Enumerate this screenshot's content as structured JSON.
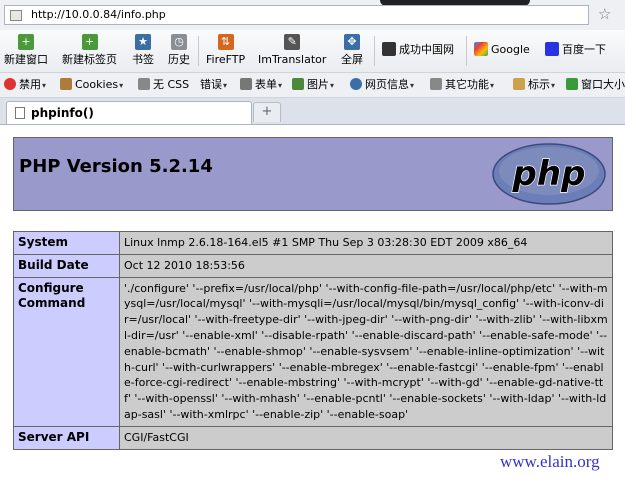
{
  "browser": {
    "url": "http://10.0.0.84/info.php",
    "toolbar": [
      {
        "label": "新建窗口",
        "icon": "new-window-icon"
      },
      {
        "label": "新建标签页",
        "icon": "new-tab-icon"
      },
      {
        "label": "书签",
        "icon": "bookmark-icon"
      },
      {
        "label": "历史",
        "icon": "history-icon"
      },
      {
        "label": "FireFTP",
        "icon": "fireftp-icon"
      },
      {
        "label": "ImTranslator",
        "icon": "translator-icon"
      },
      {
        "label": "全屏",
        "icon": "fullscreen-icon"
      }
    ],
    "toolbar_right": [
      {
        "label": "成功中国网",
        "icon": "site-icon"
      },
      {
        "label": "Google",
        "icon": "google-icon"
      },
      {
        "label": "百度一下",
        "icon": "baidu-icon"
      }
    ],
    "bookmarks": [
      "禁用",
      "Cookies",
      "无 CSS",
      "错误",
      "表单",
      "图片",
      "网页信息",
      "其它功能",
      "标示",
      "窗口大小"
    ],
    "tab_title": "phpinfo()",
    "new_tab": "+"
  },
  "page": {
    "title": "PHP Version 5.2.14",
    "logo_text": "php",
    "rows": [
      {
        "key": "System",
        "value": "Linux lnmp 2.6.18-164.el5 #1 SMP Thu Sep 3 03:28:30 EDT 2009 x86_64"
      },
      {
        "key": "Build Date",
        "value": "Oct 12 2010 18:53:56"
      },
      {
        "key": "Configure Command",
        "value": "'./configure' '--prefix=/usr/local/php' '--with-config-file-path=/usr/local/php/etc' '--with-mysql=/usr/local/mysql' '--with-mysqli=/usr/local/mysql/bin/mysql_config' '--with-iconv-dir=/usr/local' '--with-freetype-dir' '--with-jpeg-dir' '--with-png-dir' '--with-zlib' '--with-libxml-dir=/usr' '--enable-xml' '--disable-rpath' '--enable-discard-path' '--enable-safe-mode' '--enable-bcmath' '--enable-shmop' '--enable-sysvsem' '--enable-inline-optimization' '--with-curl' '--with-curlwrappers' '--enable-mbregex' '--enable-fastcgi' '--enable-fpm' '--enable-force-cgi-redirect' '--enable-mbstring' '--with-mcrypt' '--with-gd' '--enable-gd-native-ttf' '--with-openssl' '--with-mhash' '--enable-pcntl' '--enable-sockets' '--with-ldap' '--with-ldap-sasl' '--with-xmlrpc' '--enable-zip' '--enable-soap'"
      },
      {
        "key": "Server API",
        "value": "CGI/FastCGI"
      }
    ],
    "watermark": "www.elain.org"
  },
  "colors": {
    "header_bg": "#9999cc",
    "key_bg": "#ccccff",
    "value_bg": "#cccccc",
    "watermark": "#3333cc"
  }
}
